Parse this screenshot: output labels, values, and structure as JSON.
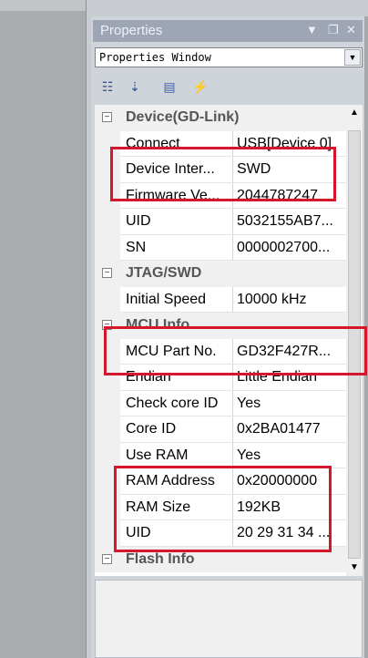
{
  "window": {
    "title": "Properties",
    "pin_glyph": "▼",
    "dock_glyph": "❐",
    "close_glyph": "✕"
  },
  "selector": {
    "value": "Properties Window",
    "arrow_glyph": "▼"
  },
  "toolbar": {
    "items": [
      {
        "name": "categorized-icon",
        "glyph": "☷"
      },
      {
        "name": "alphabetical-icon",
        "glyph": "⇣"
      },
      {
        "name": "property-pages-icon",
        "glyph": "▤"
      },
      {
        "name": "events-icon",
        "glyph": "⚡"
      }
    ]
  },
  "properties": {
    "device": {
      "label": "Device(GD-Link)",
      "toggle": "−",
      "rows": [
        {
          "name": "Connect",
          "value": "USB[Device 0]"
        },
        {
          "name": "Device Inter...",
          "value": "SWD"
        },
        {
          "name": "Firmware Ve...",
          "value": "2044787247"
        },
        {
          "name": "UID",
          "value": "5032155AB7..."
        },
        {
          "name": "SN",
          "value": "0000002700..."
        }
      ]
    },
    "jtag": {
      "label": "JTAG/SWD",
      "toggle": "−",
      "rows": [
        {
          "name": "Initial Speed",
          "value": "10000 kHz"
        }
      ]
    },
    "mcu": {
      "label": "MCU Info",
      "toggle": "−",
      "rows": [
        {
          "name": "MCU Part No.",
          "value": "GD32F427R..."
        },
        {
          "name": "Endian",
          "value": "Little Endian"
        },
        {
          "name": "Check core ID",
          "value": "Yes"
        },
        {
          "name": "Core ID",
          "value": "0x2BA01477"
        },
        {
          "name": "Use RAM",
          "value": "Yes"
        },
        {
          "name": "RAM Address",
          "value": "0x20000000"
        },
        {
          "name": "RAM Size",
          "value": "192KB"
        },
        {
          "name": "UID",
          "value": "20 29 31 34 ..."
        }
      ]
    },
    "flash": {
      "label": "Flash Info",
      "toggle": "−"
    }
  },
  "scroll": {
    "up_glyph": "▲",
    "down_glyph": "▼"
  },
  "colors": {
    "highlight": "#d4172b",
    "title_bar": "#9ea6b6",
    "panel_bg": "#cfd3da"
  }
}
